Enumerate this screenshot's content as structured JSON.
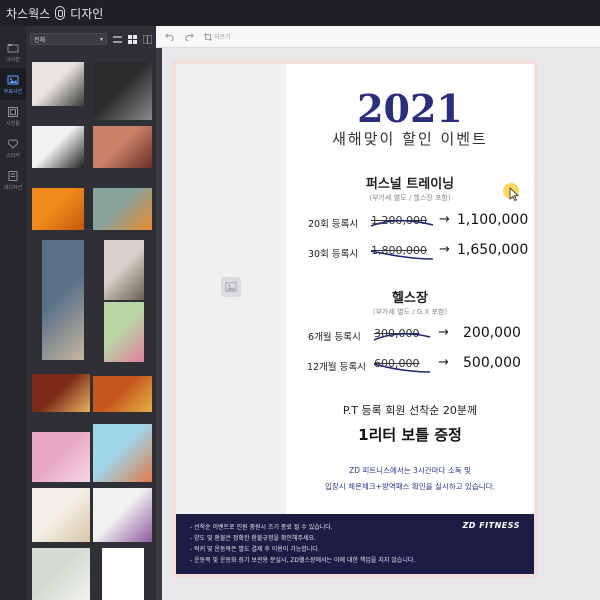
{
  "app": {
    "title_part1": "차스웍스",
    "title_part2": "디자인"
  },
  "rail": {
    "items": [
      {
        "label": "내사진",
        "icon": "folder-icon"
      },
      {
        "label": "무료사진",
        "icon": "free-photo-icon"
      },
      {
        "label": "사진틀",
        "icon": "frame-icon"
      },
      {
        "label": "스티커",
        "icon": "heart-sticker-icon"
      },
      {
        "label": "내디자인",
        "icon": "my-design-icon"
      }
    ]
  },
  "panel": {
    "theme_select": "전체",
    "thumbnails": [
      {
        "name": "dumbbell-woman-photo",
        "colors": [
          "#e9e6e2",
          "#3b3a38"
        ]
      },
      {
        "name": "gym-barbell-photo",
        "colors": [
          "#2b2b2b",
          "#8a8a8a"
        ]
      },
      {
        "name": "dumbbells-photo",
        "colors": [
          "#f2f2f2",
          "#222222"
        ]
      },
      {
        "name": "cake-photo",
        "colors": [
          "#c9826a",
          "#6b2f22"
        ]
      },
      {
        "name": "tangerines-photo",
        "colors": [
          "#f08a1c",
          "#c25a0a"
        ]
      },
      {
        "name": "tangerine-bowl-photo",
        "colors": [
          "#8aa39a",
          "#e98b2c"
        ]
      },
      {
        "name": "family-beach-photo",
        "colors": [
          "#5a7088",
          "#c7b8a2"
        ]
      },
      {
        "name": "family-sunset-photo",
        "colors": [
          "#d9d2c8",
          "#6a5e52"
        ]
      },
      {
        "name": "child-smile-photo",
        "colors": [
          "#b9d6a6",
          "#e07e9c"
        ]
      },
      {
        "name": "pizza-photo",
        "colors": [
          "#7a2a16",
          "#e6b25e"
        ]
      },
      {
        "name": "juice-glasses-photo",
        "colors": [
          "#c6561c",
          "#e3b042"
        ]
      },
      {
        "name": "macarons-photo",
        "colors": [
          "#e8a8c4",
          "#f7d4e6"
        ]
      },
      {
        "name": "smoothie-photo",
        "colors": [
          "#9fd6e6",
          "#e07a4a"
        ]
      },
      {
        "name": "yogurt-cup-photo",
        "colors": [
          "#f4efe6",
          "#d8c8aa"
        ]
      },
      {
        "name": "berry-smoothie-photo",
        "colors": [
          "#f2f2f2",
          "#8e5aa0"
        ]
      },
      {
        "name": "drink-glass-photo",
        "colors": [
          "#d4dcd0",
          "#f1f1ee"
        ]
      },
      {
        "name": "blank-white-photo",
        "colors": [
          "#ffffff",
          "#ffffff"
        ]
      }
    ]
  },
  "toolbar": {
    "undo_icon": "undo-icon",
    "redo_icon": "redo-icon",
    "crop_label": "자르기"
  },
  "poster": {
    "year": "2021",
    "event_title": "새해맞이 할인 이벤트",
    "section1": {
      "title": "퍼스널 트레이닝",
      "note": "(부가세 별도 / 헬스장 포함)",
      "rows": [
        {
          "label": "20회 등록시",
          "old": "1,200,000",
          "arrow": "→",
          "new": "1,100,000"
        },
        {
          "label": "30회 등록시",
          "old": "1,800,000",
          "arrow": "→",
          "new": "1,650,000"
        }
      ]
    },
    "section2": {
      "title": "헬스장",
      "note": "(부가세 별도 / G.X 포함)",
      "rows": [
        {
          "label": "6개월 등록시",
          "old": "300,000",
          "arrow": "→",
          "new": "200,000"
        },
        {
          "label": "12개월 등록시",
          "old": "600,000",
          "arrow": "→",
          "new": "500,000"
        }
      ]
    },
    "pt_line": "P.T 등록 회원 선착순 20분께",
    "gift": "1리터 보틀 증정",
    "notice1": "ZD 피트니스에서는 3시간마다 소독 및",
    "notice2": "입장시 체온체크+방역패스 확인을 실시하고 있습니다.",
    "footer": {
      "brand": "ZD FITNESS",
      "lines": [
        "- 선착순 이벤트로 인원 충원시 조기 종료 될 수 있습니다.",
        "- 양도 및 환불은 정확한 환불규정을 확인해주세요.",
        "- 락커 및 운동복은 별도 결제 후 이용이 가능합니다.",
        "- 운동복 및 운동화 장기 보관용 분실시, ZD헬스장에서는 이에 대한 책임을 지지 않습니다."
      ]
    }
  },
  "colors": {
    "poster_navy": "#1d1c44",
    "year_blue": "#2a2f78",
    "accent_blue": "#5ea3ff",
    "cursor_highlight": "#ffc828"
  }
}
